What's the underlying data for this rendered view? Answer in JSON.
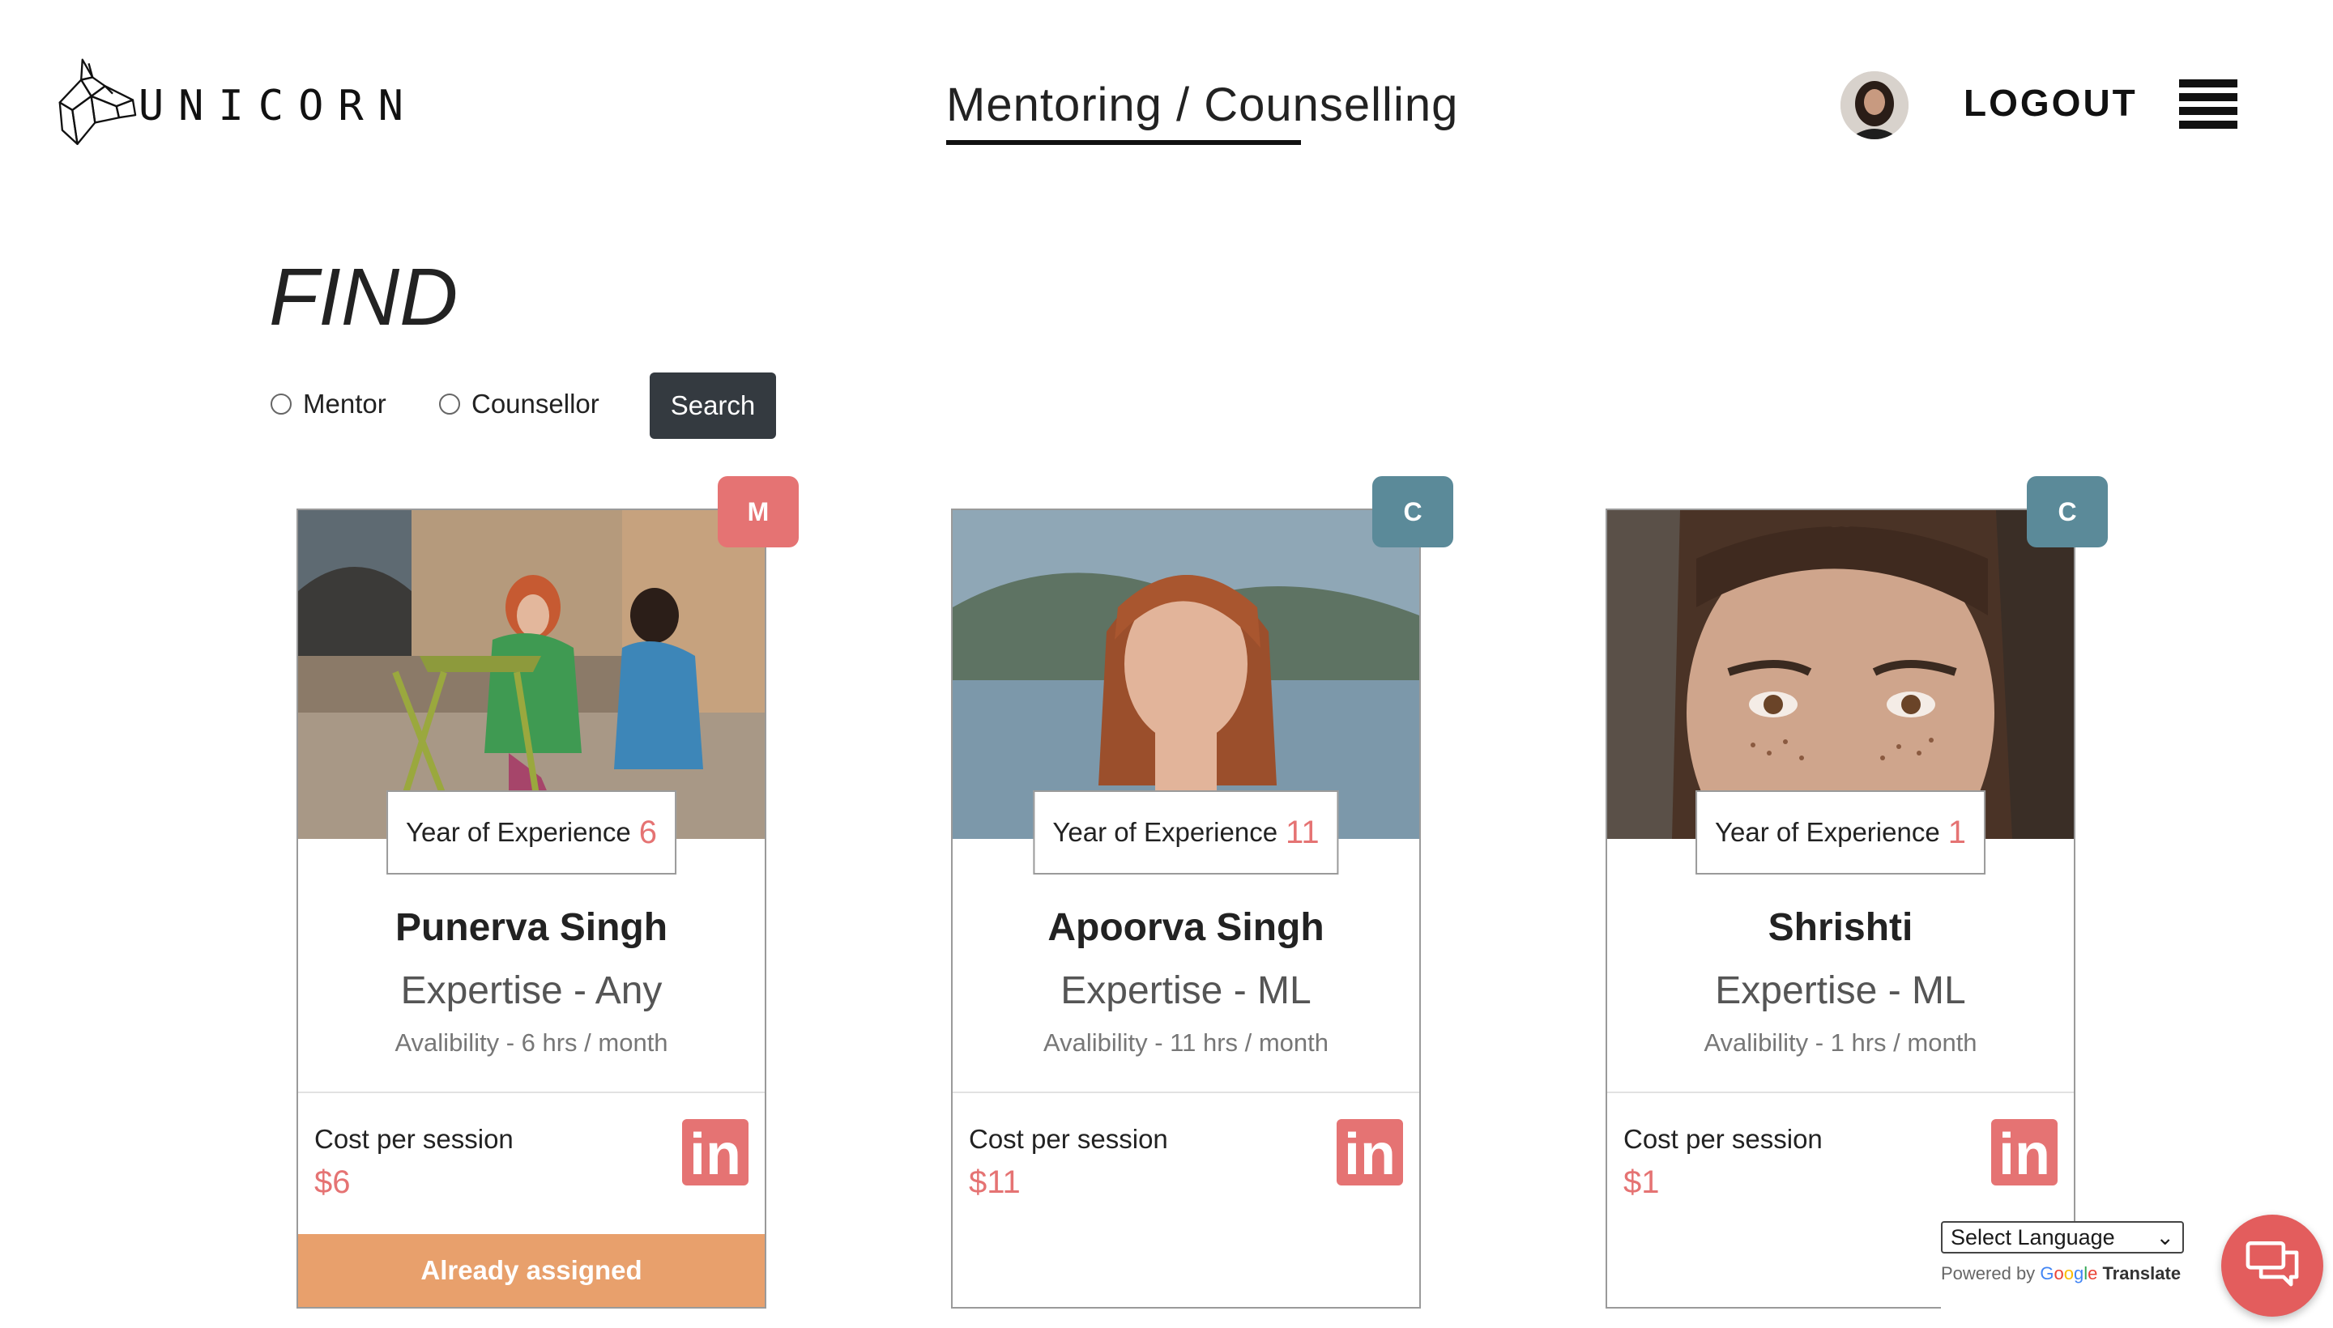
{
  "header": {
    "logo_text": "UNICORN",
    "nav_title": "Mentoring / Counselling",
    "logout_label": "LOGOUT"
  },
  "find": {
    "title": "FIND",
    "radio_mentor": "Mentor",
    "radio_counsellor": "Counsellor",
    "search_label": "Search"
  },
  "cards": [
    {
      "badge": "M",
      "badge_color": "#e57373",
      "exp_label": "Year of Experience",
      "exp_years": "6",
      "name": "Punerva Singh",
      "expertise": "Expertise - Any",
      "availability": "Avalibility - 6 hrs / month",
      "cost_label": "Cost per session",
      "cost": "$6",
      "action_label": "Already assigned"
    },
    {
      "badge": "C",
      "badge_color": "#5b8a99",
      "exp_label": "Year of Experience",
      "exp_years": "11",
      "name": "Apoorva Singh",
      "expertise": "Expertise - ML",
      "availability": "Avalibility - 11 hrs / month",
      "cost_label": "Cost per session",
      "cost": "$11"
    },
    {
      "badge": "C",
      "badge_color": "#5b8a99",
      "exp_label": "Year of Experience",
      "exp_years": "1",
      "name": "Shrishti",
      "expertise": "Expertise - ML",
      "availability": "Avalibility - 1 hrs / month",
      "cost_label": "Cost per session",
      "cost": "$1"
    }
  ],
  "translate": {
    "select_label": "Select Language",
    "powered_by": "Powered by",
    "google": "Google",
    "translate": "Translate"
  },
  "icons": {
    "linkedin": "linkedin-icon",
    "chat": "chat-icon",
    "menu": "hamburger-menu-icon"
  }
}
